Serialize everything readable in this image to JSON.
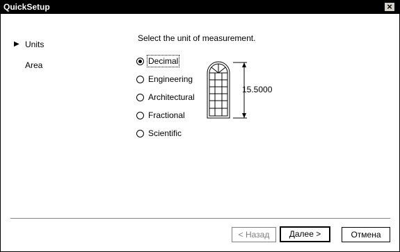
{
  "window": {
    "title": "QuickSetup",
    "close_label": "×"
  },
  "nav": {
    "arrow": "▶",
    "items": [
      {
        "label": "Units"
      },
      {
        "label": "Area"
      }
    ]
  },
  "main": {
    "prompt": "Select the unit of measurement.",
    "options": [
      {
        "label": "Decimal",
        "checked": true
      },
      {
        "label": "Engineering",
        "checked": false
      },
      {
        "label": "Architectural",
        "checked": false
      },
      {
        "label": "Fractional",
        "checked": false
      },
      {
        "label": "Scientific",
        "checked": false
      }
    ],
    "preview": {
      "dimension": "15.5000"
    }
  },
  "buttons": {
    "back": "< Назад",
    "next": "Далее >",
    "cancel": "Отмена"
  }
}
